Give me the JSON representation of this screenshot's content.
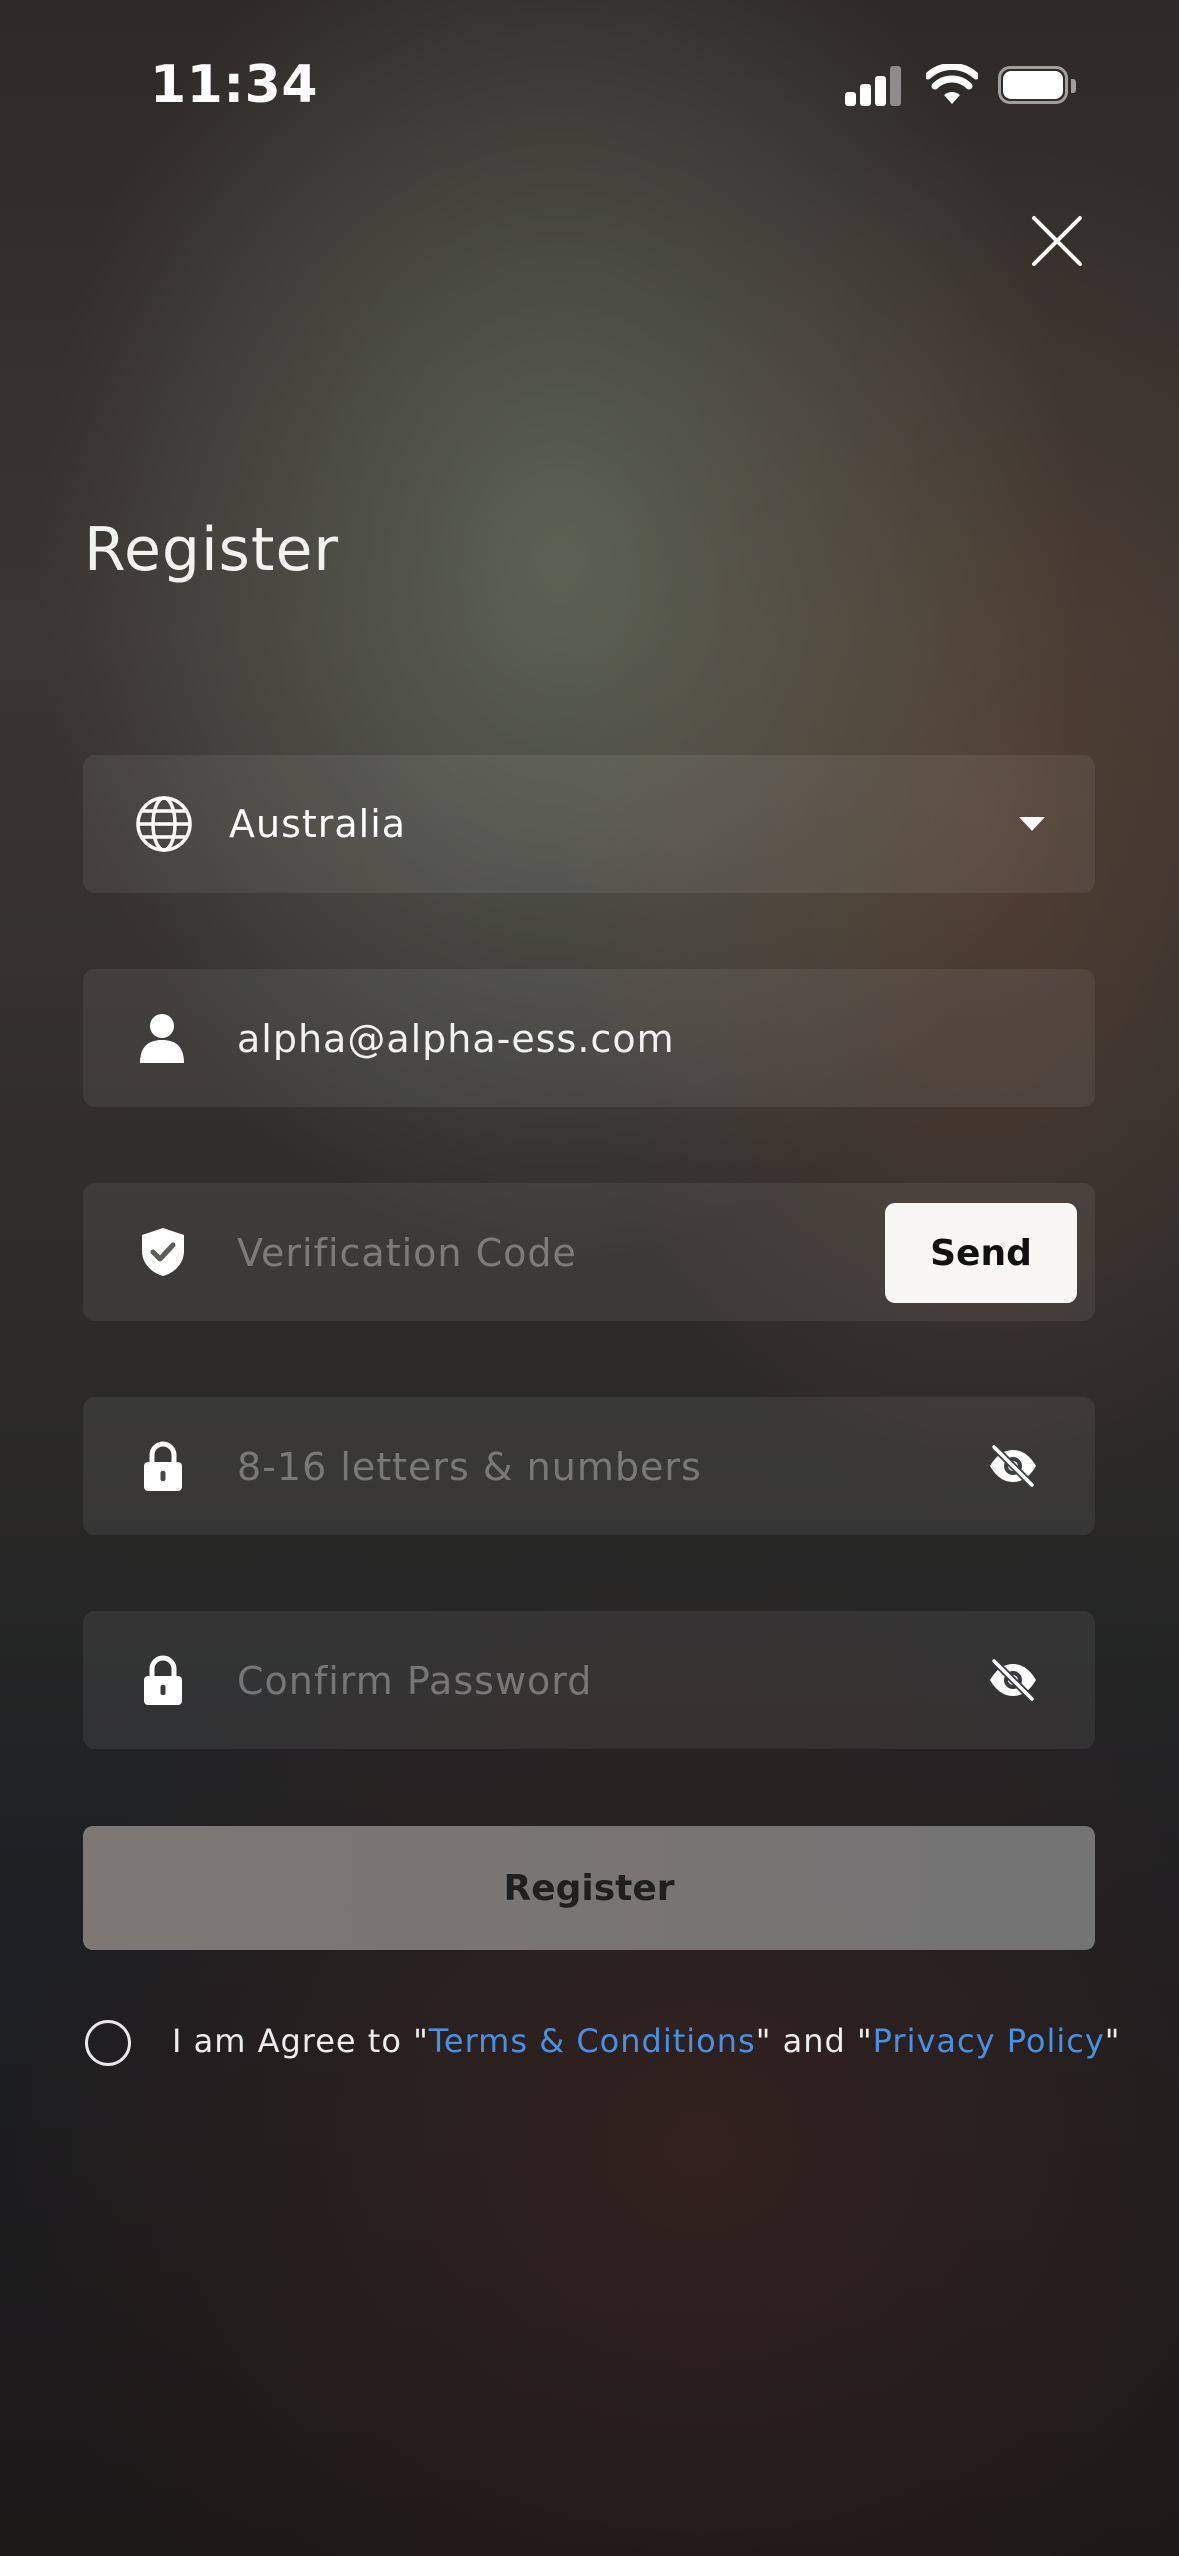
{
  "status_bar": {
    "time": "11:34"
  },
  "page": {
    "title": "Register"
  },
  "country": {
    "value": "Australia"
  },
  "email": {
    "value": "alpha@alpha-ess.com"
  },
  "verification": {
    "placeholder": "Verification Code",
    "send_label": "Send"
  },
  "password": {
    "placeholder": "8-16 letters & numbers"
  },
  "confirm_password": {
    "placeholder": "Confirm Password"
  },
  "register_button": {
    "label": "Register"
  },
  "agreement": {
    "prefix": "I am Agree to \"",
    "terms_label": "Terms & Conditions",
    "middle": "\" and \"",
    "privacy_label": "Privacy Policy",
    "suffix": "\""
  },
  "colors": {
    "link": "#4a90e2",
    "send_button_bg": "#f8f7f3",
    "register_button_bg": "#777574"
  }
}
